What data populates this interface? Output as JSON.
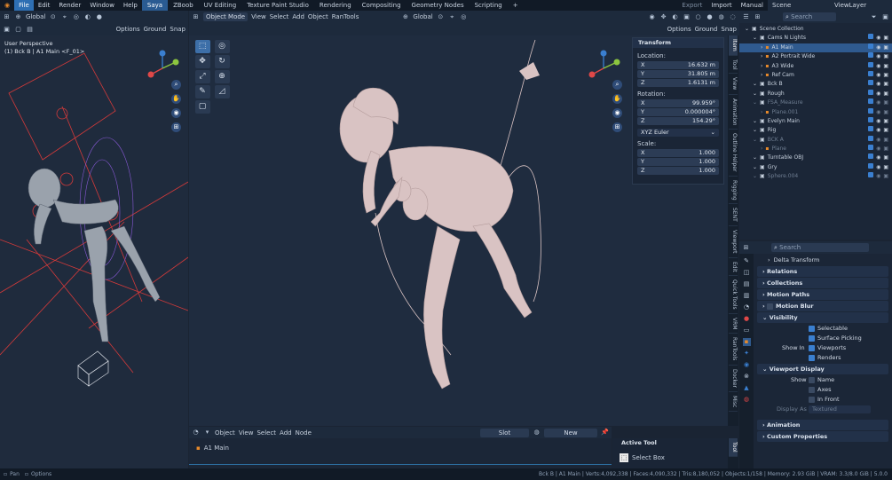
{
  "menubar": {
    "menus": [
      "File",
      "Edit",
      "Render",
      "Window",
      "Help"
    ],
    "workspaces": [
      "Saya",
      "ZBoob",
      "UV Editing",
      "Texture Paint Studio",
      "Rendering",
      "Compositing",
      "Geometry Nodes",
      "Scripting"
    ],
    "active_workspace": "Saya",
    "add_tab": "+",
    "export": "Export",
    "import": "Import",
    "manual": "Manual",
    "scene": "Scene",
    "viewlayer": "ViewLayer"
  },
  "left_viewport": {
    "transform_orientation": "Global",
    "options": "Options",
    "ground": "Ground",
    "snap": "Snap",
    "title": "User Perspective",
    "subtitle": "(1) Bck B | A1 Main <F_01>"
  },
  "main_viewport": {
    "mode": "Object Mode",
    "menus": [
      "View",
      "Select",
      "Add",
      "Object",
      "RanTools"
    ],
    "orientation": "Global",
    "options": "Options",
    "ground": "Ground",
    "snap": "Snap"
  },
  "n_panel": {
    "tab_active": "Item",
    "tabs": [
      "Item",
      "Tool",
      "View",
      "Animation",
      "Outline Helper",
      "Rigging",
      "SENT",
      "Viewport",
      "Edit",
      "Quick Tools",
      "VRM",
      "RanTools",
      "Docker",
      "Misc"
    ],
    "section": "Transform",
    "location_label": "Location:",
    "location": [
      {
        "axis": "X",
        "value": "16.632 m"
      },
      {
        "axis": "Y",
        "value": "31.805 m"
      },
      {
        "axis": "Z",
        "value": "1.6131 m"
      }
    ],
    "rotation_label": "Rotation:",
    "rotation": [
      {
        "axis": "X",
        "value": "99.959°"
      },
      {
        "axis": "Y",
        "value": "0.000004°"
      },
      {
        "axis": "Z",
        "value": "154.29°"
      }
    ],
    "rotation_mode": "XYZ Euler",
    "scale_label": "Scale:",
    "scale": [
      {
        "axis": "X",
        "value": "1.000"
      },
      {
        "axis": "Y",
        "value": "1.000"
      },
      {
        "axis": "Z",
        "value": "1.000"
      }
    ]
  },
  "outliner": {
    "search_placeholder": "Search",
    "items": [
      {
        "label": "Scene Collection",
        "level": 0,
        "dim": false,
        "selected": false
      },
      {
        "label": "Cams N Lights",
        "level": 1,
        "dim": false,
        "selected": false
      },
      {
        "label": "A1 Main",
        "level": 2,
        "dim": false,
        "selected": true
      },
      {
        "label": "A2 Portrait Wide",
        "level": 2,
        "dim": false,
        "selected": false
      },
      {
        "label": "A3 Wide",
        "level": 2,
        "dim": false,
        "selected": false
      },
      {
        "label": "Ref Cam",
        "level": 2,
        "dim": false,
        "selected": false
      },
      {
        "label": "Bck B",
        "level": 1,
        "dim": false,
        "selected": false
      },
      {
        "label": "Rough",
        "level": 1,
        "dim": false,
        "selected": false
      },
      {
        "label": "FSA_Measure",
        "level": 1,
        "dim": true,
        "selected": false
      },
      {
        "label": "Plane.001",
        "level": 2,
        "dim": true,
        "selected": false
      },
      {
        "label": "Evelyn Main",
        "level": 1,
        "dim": false,
        "selected": false
      },
      {
        "label": "Rig",
        "level": 1,
        "dim": false,
        "selected": false
      },
      {
        "label": "BCK A",
        "level": 1,
        "dim": true,
        "selected": false
      },
      {
        "label": "Plane",
        "level": 2,
        "dim": true,
        "selected": false
      },
      {
        "label": "Turntable OBJ",
        "level": 1,
        "dim": false,
        "selected": false
      },
      {
        "label": "Gry",
        "level": 1,
        "dim": false,
        "selected": false
      },
      {
        "label": "Sphere.004",
        "level": 1,
        "dim": true,
        "selected": false
      }
    ]
  },
  "properties": {
    "search_placeholder": "Search",
    "delta_transform": "Delta Transform",
    "sections_collapsed": [
      "Relations",
      "Collections",
      "Motion Paths",
      "Motion Blur"
    ],
    "visibility": "Visibility",
    "visibility_items": [
      {
        "label": "Selectable",
        "checked": true
      },
      {
        "label": "Surface Picking",
        "checked": true
      },
      {
        "label": "Viewports",
        "checked": true
      },
      {
        "label": "Renders",
        "checked": true
      }
    ],
    "show_in": "Show In",
    "viewport_display": "Viewport Display",
    "show": "Show",
    "show_items": [
      {
        "label": "Name",
        "checked": false
      },
      {
        "label": "Axes",
        "checked": false
      },
      {
        "label": "In Front",
        "checked": false
      }
    ],
    "display_as_label": "Display As",
    "display_as_value": "Textured",
    "animation": "Animation",
    "custom_properties": "Custom Properties"
  },
  "node_editor": {
    "type": "Object",
    "menus": [
      "View",
      "Select",
      "Add",
      "Node"
    ],
    "slot": "Slot",
    "new": "New",
    "breadcrumb": "A1 Main"
  },
  "active_tool": {
    "title": "Active Tool",
    "tool": "Select Box",
    "tab": "Tool"
  },
  "status": {
    "pan": "Pan",
    "options": "Options",
    "stats": "Bck B | A1 Main | Verts:4,092,338 | Faces:4,090,332 | Tris:8,180,052 | Objects:1/158 | Memory: 2.93 GiB | VRAM: 3.3/8.0 GiB | 5.0.0"
  }
}
